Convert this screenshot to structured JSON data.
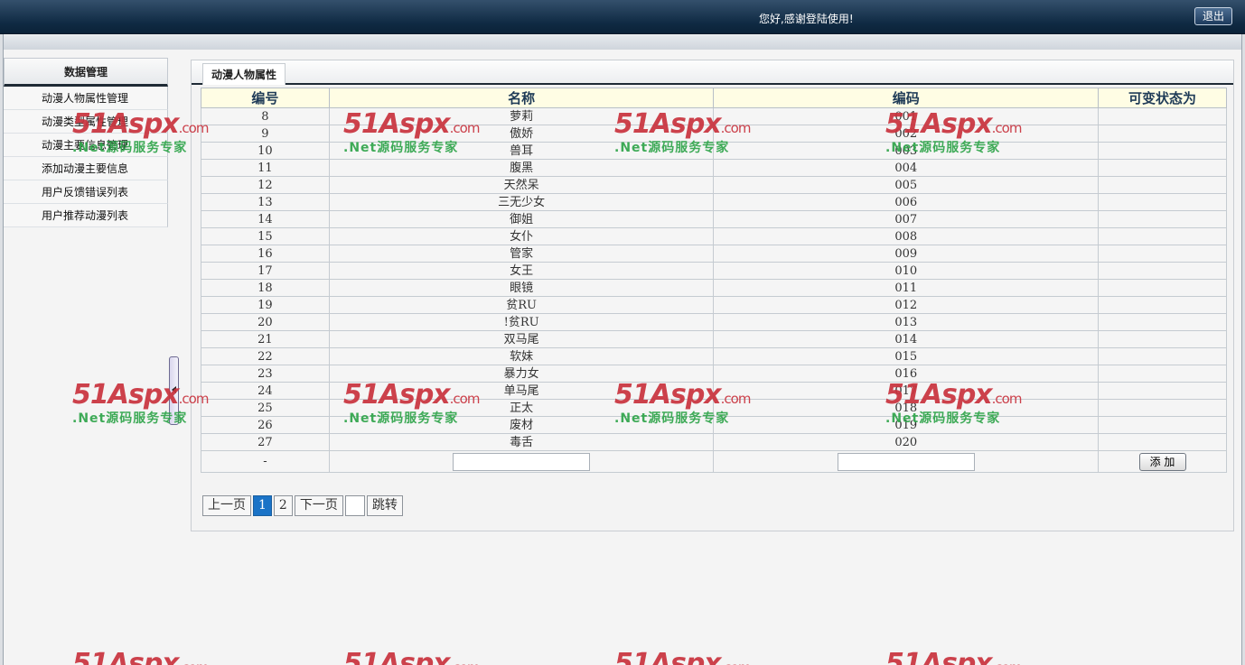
{
  "header": {
    "welcome": "您好,感谢登陆使用!",
    "logout_label": "退出"
  },
  "sidebar": {
    "title": "数据管理",
    "items": [
      {
        "label": "动漫人物属性管理"
      },
      {
        "label": "动漫类型属性管理"
      },
      {
        "label": "动漫主要信息管理"
      },
      {
        "label": "添加动漫主要信息"
      },
      {
        "label": "用户反馈错误列表"
      },
      {
        "label": "用户推荐动漫列表"
      }
    ]
  },
  "panel": {
    "tab_label": "动漫人物属性",
    "columns": [
      "编号",
      "名称",
      "编码",
      "可变状态为"
    ],
    "rows": [
      {
        "id": "8",
        "name": "萝莉",
        "code": "001",
        "state": ""
      },
      {
        "id": "9",
        "name": "傲娇",
        "code": "002",
        "state": ""
      },
      {
        "id": "10",
        "name": "兽耳",
        "code": "003",
        "state": ""
      },
      {
        "id": "11",
        "name": "腹黑",
        "code": "004",
        "state": ""
      },
      {
        "id": "12",
        "name": "天然呆",
        "code": "005",
        "state": ""
      },
      {
        "id": "13",
        "name": "三无少女",
        "code": "006",
        "state": ""
      },
      {
        "id": "14",
        "name": "御姐",
        "code": "007",
        "state": ""
      },
      {
        "id": "15",
        "name": "女仆",
        "code": "008",
        "state": ""
      },
      {
        "id": "16",
        "name": "管家",
        "code": "009",
        "state": ""
      },
      {
        "id": "17",
        "name": "女王",
        "code": "010",
        "state": ""
      },
      {
        "id": "18",
        "name": "眼镜",
        "code": "011",
        "state": ""
      },
      {
        "id": "19",
        "name": "贫RU",
        "code": "012",
        "state": ""
      },
      {
        "id": "20",
        "name": "!贫RU",
        "code": "013",
        "state": ""
      },
      {
        "id": "21",
        "name": "双马尾",
        "code": "014",
        "state": ""
      },
      {
        "id": "22",
        "name": "软妹",
        "code": "015",
        "state": ""
      },
      {
        "id": "23",
        "name": "暴力女",
        "code": "016",
        "state": ""
      },
      {
        "id": "24",
        "name": "单马尾",
        "code": "017",
        "state": ""
      },
      {
        "id": "25",
        "name": "正太",
        "code": "018",
        "state": ""
      },
      {
        "id": "26",
        "name": "废材",
        "code": "019",
        "state": ""
      },
      {
        "id": "27",
        "name": "毒舌",
        "code": "020",
        "state": ""
      }
    ],
    "add_row": {
      "id_placeholder": "-",
      "name_value": "",
      "code_value": "",
      "add_label": "添 加"
    }
  },
  "pager": {
    "prev_label": "上一页",
    "pages": [
      "1",
      "2"
    ],
    "current_page": "1",
    "next_label": "下一页",
    "jump_value": "",
    "jump_label": "跳转"
  },
  "watermark": {
    "logo": "51Aspx",
    "logo_suffix": ".com",
    "tagline": ".Net源码服务专家"
  },
  "colors": {
    "header_bg": "#0f2a43",
    "table_header_bg": "#fffde4",
    "current_page": "#1a73c7",
    "watermark_red": "#c9323d",
    "watermark_green": "#2fa44a"
  }
}
